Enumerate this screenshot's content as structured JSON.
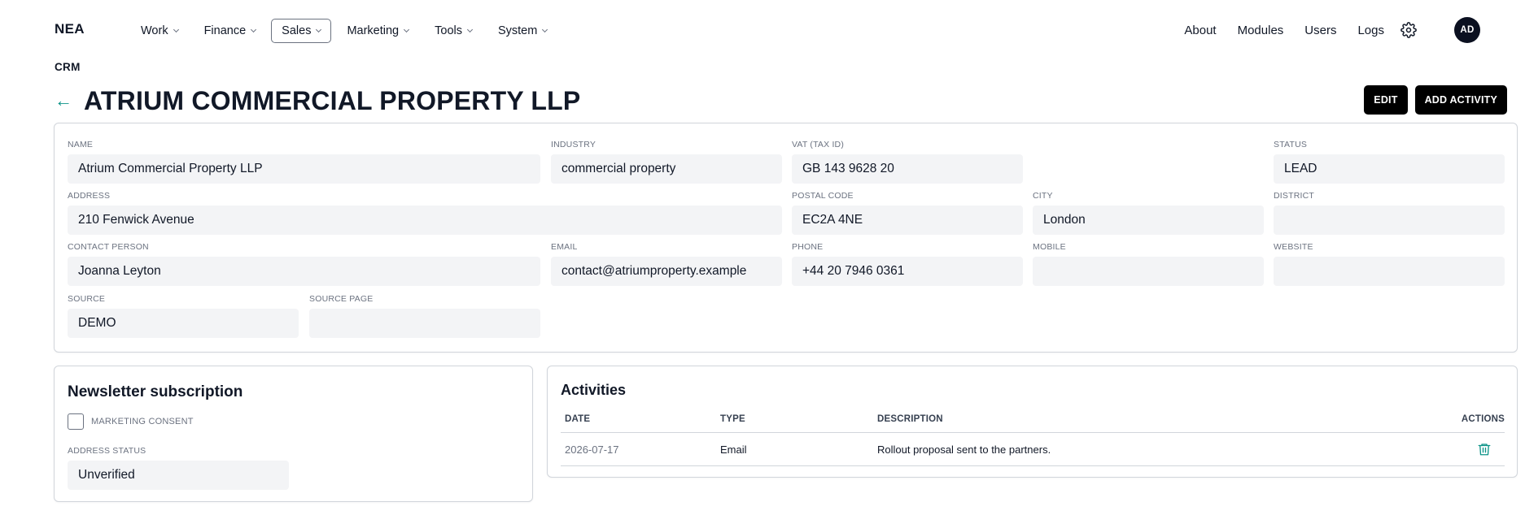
{
  "nav": {
    "brand": "NEA",
    "menu": [
      {
        "label": "Work",
        "active": false
      },
      {
        "label": "Finance",
        "active": false
      },
      {
        "label": "Sales",
        "active": true
      },
      {
        "label": "Marketing",
        "active": false
      },
      {
        "label": "Tools",
        "active": false
      },
      {
        "label": "System",
        "active": false
      }
    ],
    "right_links": [
      "About",
      "Modules",
      "Users",
      "Logs"
    ],
    "settings_icon": "gear-icon",
    "avatar_initials": "AD"
  },
  "breadcrumb": "CRM",
  "page": {
    "title": "ATRIUM COMMERCIAL PROPERTY LLP",
    "back_icon": "arrow-left-icon",
    "edit_label": "EDIT",
    "add_activity_label": "ADD ACTIVITY"
  },
  "fields": {
    "name": {
      "label": "NAME",
      "value": "Atrium Commercial Property LLP"
    },
    "industry": {
      "label": "INDUSTRY",
      "value": "commercial property"
    },
    "vat": {
      "label": "VAT (TAX ID)",
      "value": "GB 143 9628 20"
    },
    "status": {
      "label": "STATUS",
      "value": "LEAD"
    },
    "address": {
      "label": "ADDRESS",
      "value": "210 Fenwick Avenue"
    },
    "postal_code": {
      "label": "POSTAL CODE",
      "value": "EC2A 4NE"
    },
    "city": {
      "label": "CITY",
      "value": "London"
    },
    "district": {
      "label": "DISTRICT",
      "value": ""
    },
    "contact_person": {
      "label": "CONTACT PERSON",
      "value": "Joanna Leyton"
    },
    "email": {
      "label": "EMAIL",
      "value": "contact@atriumproperty.example"
    },
    "phone": {
      "label": "PHONE",
      "value": "+44 20 7946 0361"
    },
    "mobile": {
      "label": "MOBILE",
      "value": ""
    },
    "website": {
      "label": "WEBSITE",
      "value": ""
    },
    "source": {
      "label": "SOURCE",
      "value": "DEMO"
    },
    "source_page": {
      "label": "SOURCE PAGE",
      "value": ""
    }
  },
  "newsletter": {
    "title": "Newsletter subscription",
    "consent_label": "MARKETING CONSENT",
    "consent_checked": false,
    "address_status_label": "ADDRESS STATUS",
    "address_status_value": "Unverified"
  },
  "activities": {
    "title": "Activities",
    "columns": {
      "date": "DATE",
      "type": "TYPE",
      "description": "DESCRIPTION",
      "actions": "ACTIONS"
    },
    "rows": [
      {
        "date": "2026-07-17",
        "type": "Email",
        "description": "Rollout proposal sent to the partners.",
        "action_icon": "trash-icon"
      }
    ]
  },
  "colors": {
    "accent": "#0d9488",
    "button": "#000000",
    "field_bg": "#f3f4f6"
  }
}
